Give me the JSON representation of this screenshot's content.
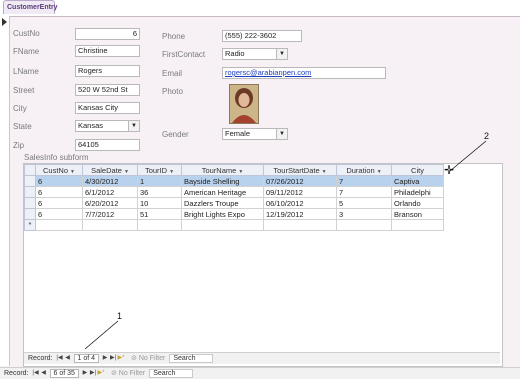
{
  "document_tab": {
    "label": "CustomerEntry"
  },
  "form": {
    "fields": {
      "custno": {
        "label": "CustNo",
        "value": "6"
      },
      "fname": {
        "label": "FName",
        "value": "Christine"
      },
      "lname": {
        "label": "LName",
        "value": "Rogers"
      },
      "street": {
        "label": "Street",
        "value": "520 W 52nd St"
      },
      "city": {
        "label": "City",
        "value": "Kansas City"
      },
      "state": {
        "label": "State",
        "value": "Kansas"
      },
      "zip": {
        "label": "Zip",
        "value": "64105"
      },
      "phone": {
        "label": "Phone",
        "value": "(555) 222-3602"
      },
      "firstcontact": {
        "label": "FirstContact",
        "value": "Radio"
      },
      "email": {
        "label": "Email",
        "value": "rogersc@arabianpen.com"
      },
      "photo": {
        "label": "Photo"
      },
      "gender": {
        "label": "Gender",
        "value": "Female"
      }
    }
  },
  "subform": {
    "label": "SalesInfo subform",
    "columns": [
      "CustNo",
      "SaleDate",
      "TourID",
      "TourName",
      "TourStartDate",
      "Duration",
      "City"
    ],
    "rows": [
      [
        "6",
        "4/30/2012",
        "1",
        "Bayside Shelling",
        "07/26/2012",
        "7",
        "Captiva"
      ],
      [
        "6",
        "6/1/2012",
        "36",
        "American Heritage",
        "09/11/2012",
        "7",
        "Philadelphi"
      ],
      [
        "6",
        "6/20/2012",
        "10",
        "Dazzlers Troupe",
        "06/10/2012",
        "5",
        "Orlando"
      ],
      [
        "6",
        "7/7/2012",
        "51",
        "Bright Lights Expo",
        "12/19/2012",
        "3",
        "Branson"
      ]
    ],
    "new_row_marker": "*",
    "navigation": {
      "record_label": "Record:",
      "position": "1 of 4",
      "filter_label": "No Filter",
      "search_label": "Search"
    }
  },
  "main_navigation": {
    "record_label": "Record:",
    "position": "6 of 35",
    "filter_label": "No Filter",
    "search_label": "Search"
  },
  "callouts": {
    "one": "1",
    "two": "2"
  },
  "colors": {
    "selected_row": "#b8d1ed",
    "form_bg": "#f7f1f5",
    "link": "#1e3fbf"
  }
}
